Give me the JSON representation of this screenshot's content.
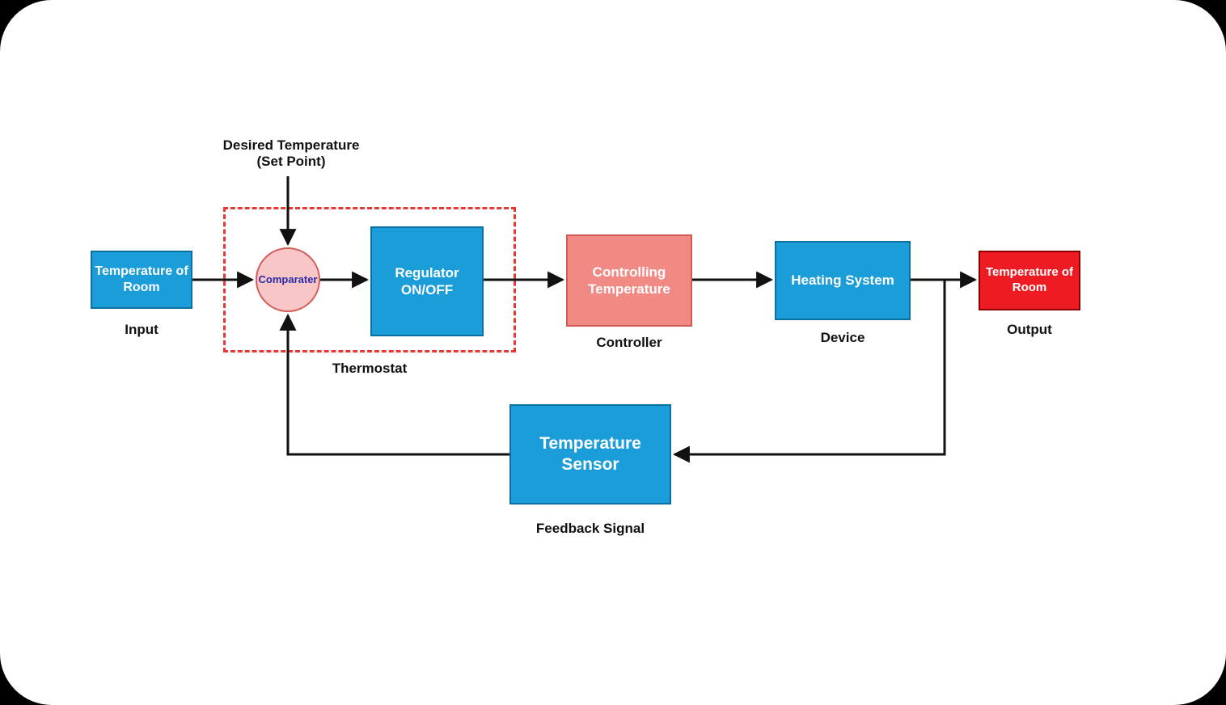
{
  "diagram": {
    "nodes": {
      "input_block": {
        "text": "Temperature\nof Room"
      },
      "comparator": {
        "text": "Comparater"
      },
      "regulator": {
        "text": "Regulator\nON/OFF"
      },
      "controller": {
        "text": "Controlling\nTemperature"
      },
      "device": {
        "text": "Heating System"
      },
      "output_block": {
        "text": "Temperature\nof Room"
      },
      "feedback_sensor": {
        "text": "Temperature\nSensor"
      }
    },
    "labels": {
      "input": "Input",
      "thermostat": "Thermostat",
      "controller": "Controller",
      "device": "Device",
      "output": "Output",
      "feedback": "Feedback Signal",
      "setpoint": "Desired Temperature\n(Set Point)"
    },
    "colors": {
      "blue": "#1b9dd9",
      "coral": "#f18a84",
      "red": "#ed1c24",
      "pink": "#f8c6c6",
      "dash": "#e53935",
      "arrow": "#111111"
    }
  }
}
